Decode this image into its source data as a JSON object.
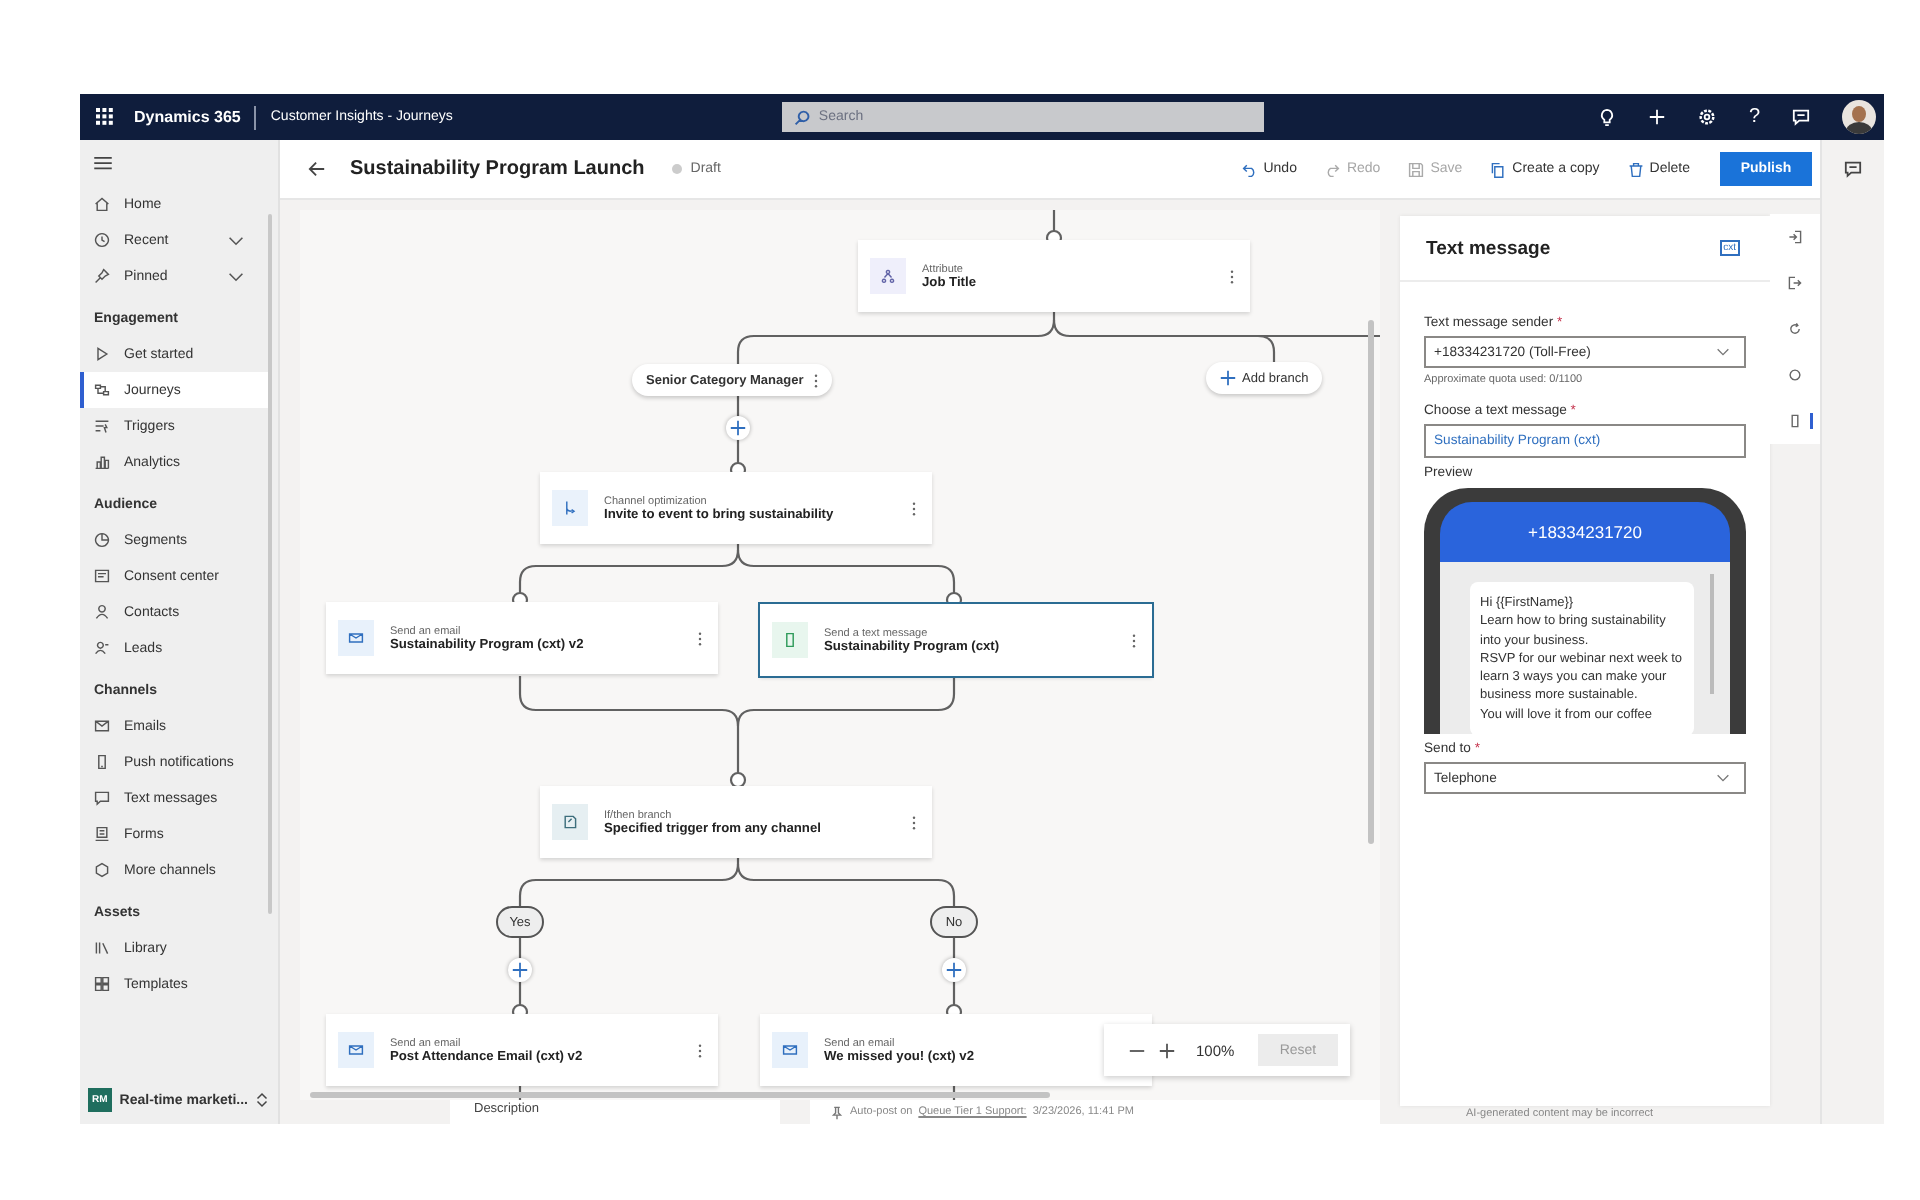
{
  "top_bar": {
    "app_name": "Dynamics 365",
    "app_area": "Customer Insights - Journeys",
    "search": {
      "placeholder": "Search"
    },
    "help_glyph": "?"
  },
  "sidebar": {
    "sections": [
      {
        "items": [
          {
            "label": "Home",
            "kind": "link",
            "selected": false
          },
          {
            "label": "Recent",
            "kind": "expandable",
            "selected": false
          },
          {
            "label": "Pinned",
            "kind": "expandable",
            "selected": false
          }
        ]
      },
      {
        "heading": "Engagement",
        "items": [
          {
            "label": "Get started",
            "kind": "link",
            "selected": false
          },
          {
            "label": "Journeys",
            "kind": "link",
            "selected": true
          },
          {
            "label": "Triggers",
            "kind": "link",
            "selected": false
          },
          {
            "label": "Analytics",
            "kind": "link",
            "selected": false
          }
        ]
      },
      {
        "heading": "Audience",
        "items": [
          {
            "label": "Segments",
            "kind": "link",
            "selected": false
          },
          {
            "label": "Consent center",
            "kind": "link",
            "selected": false
          },
          {
            "label": "Contacts",
            "kind": "link",
            "selected": false
          },
          {
            "label": "Leads",
            "kind": "link",
            "selected": false
          }
        ]
      },
      {
        "heading": "Channels",
        "items": [
          {
            "label": "Emails",
            "kind": "link",
            "selected": false
          },
          {
            "label": "Push notifications",
            "kind": "link",
            "selected": false
          },
          {
            "label": "Text messages",
            "kind": "link",
            "selected": false
          },
          {
            "label": "Forms",
            "kind": "link",
            "selected": false
          },
          {
            "label": "More channels",
            "kind": "link",
            "selected": false
          }
        ]
      },
      {
        "heading": "Assets",
        "items": [
          {
            "label": "Library",
            "kind": "link",
            "selected": false
          },
          {
            "label": "Templates",
            "kind": "link",
            "selected": false
          }
        ]
      }
    ],
    "area": {
      "badge": "RM",
      "label": "Real-time marketi..."
    }
  },
  "command_bar": {
    "title": "Sustainability Program Launch",
    "status": "Draft",
    "actions": [
      {
        "label": "Undo",
        "disabled": false
      },
      {
        "label": "Redo",
        "disabled": true
      },
      {
        "label": "Save",
        "disabled": true
      },
      {
        "label": "Create a copy",
        "disabled": false
      },
      {
        "label": "Delete",
        "disabled": false
      }
    ],
    "publish": "Publish"
  },
  "canvas": {
    "nodes": [
      {
        "kind": "attribute",
        "type_label": "Attribute",
        "title": "Job Title",
        "selected": false
      },
      {
        "kind": "channel",
        "type_label": "Channel optimization",
        "title": "Invite to event to bring sustainability",
        "selected": false
      },
      {
        "kind": "email",
        "type_label": "Send an email",
        "title": "Sustainability Program (cxt) v2",
        "selected": false
      },
      {
        "kind": "sms",
        "type_label": "Send a text message",
        "title": "Sustainability Program (cxt)",
        "selected": true
      },
      {
        "kind": "ifthen",
        "type_label": "If/then branch",
        "title": "Specified trigger from any channel",
        "selected": false
      },
      {
        "kind": "email",
        "type_label": "Send an email",
        "title": "Post Attendance Email (cxt) v2",
        "selected": false
      },
      {
        "kind": "email",
        "type_label": "Send an email",
        "title": "We missed you! (cxt) v2",
        "selected": false
      }
    ],
    "branch": "Senior Category Manager",
    "add_branch": "Add branch",
    "outcomes": [
      "Yes",
      "No"
    ],
    "zoom": {
      "value": "100%",
      "reset": "Reset"
    }
  },
  "footer": {
    "description": "Description",
    "post_prefix": "Auto-post on",
    "post_link": "Queue Tier 1 Support:",
    "post_time": "3/23/2026, 11:41 PM",
    "ai_note": "AI-generated content may be incorrect"
  },
  "panel": {
    "title": "Text message",
    "badge": "cxt",
    "sender": {
      "label": "Text message sender",
      "required_mark": "*",
      "value": "+18334231720 (Toll-Free)",
      "hint": "Approximate quota used: 0/1100"
    },
    "message": {
      "label": "Choose a text message",
      "required_mark": "*",
      "value": "Sustainability Program (cxt)"
    },
    "preview": {
      "label": "Preview",
      "number": "+18334231720",
      "lines": [
        "Hi {{FirstName}}",
        "Learn how to bring sustainability into your business.",
        "RSVP for our webinar next week to learn 3 ways you can make your business more sustainable.",
        "You will love it from our coffee"
      ]
    },
    "send_to": {
      "label": "Send to",
      "required_mark": "*",
      "value": "Telephone"
    }
  },
  "rail": [
    {
      "selected": false
    },
    {
      "selected": false
    },
    {
      "selected": false
    },
    {
      "selected": false
    },
    {
      "selected": true
    }
  ]
}
